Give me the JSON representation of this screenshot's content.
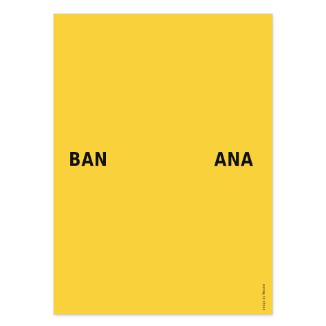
{
  "poster": {
    "background_color": "#f9d13a",
    "text_color": "#111111",
    "word_left": "BAN",
    "word_right": "ANA",
    "credit": "design by Weuller"
  }
}
